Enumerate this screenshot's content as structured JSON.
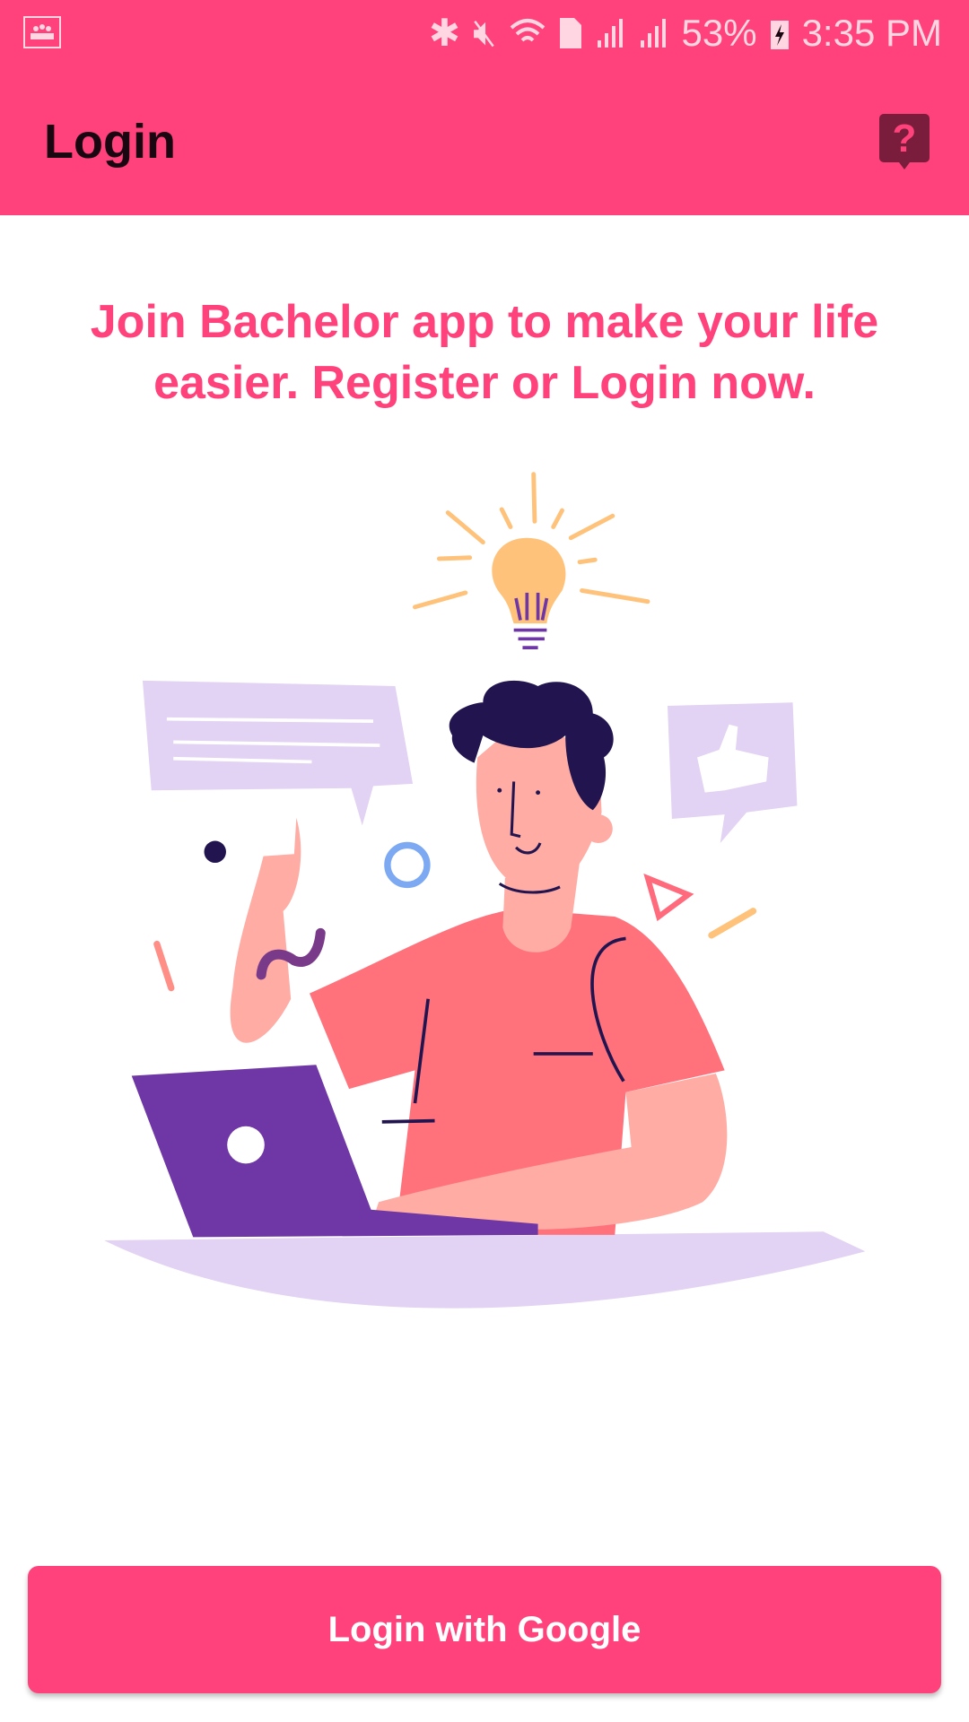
{
  "status_bar": {
    "battery": "53%",
    "time": "3:35 PM",
    "icons": [
      "notification-icon",
      "bluetooth-icon",
      "mute-icon",
      "wifi-icon",
      "sim-icon",
      "signal-icon",
      "signal-icon",
      "battery-charging-icon"
    ]
  },
  "app_bar": {
    "title": "Login",
    "help_icon": "help-icon"
  },
  "main": {
    "headline": "Join Bachelor app to make your life easier. Register or Login now."
  },
  "login_button": {
    "label": "Login with Google"
  },
  "colors": {
    "primary": "#ff427b",
    "help_icon": "#7a1c3c"
  }
}
